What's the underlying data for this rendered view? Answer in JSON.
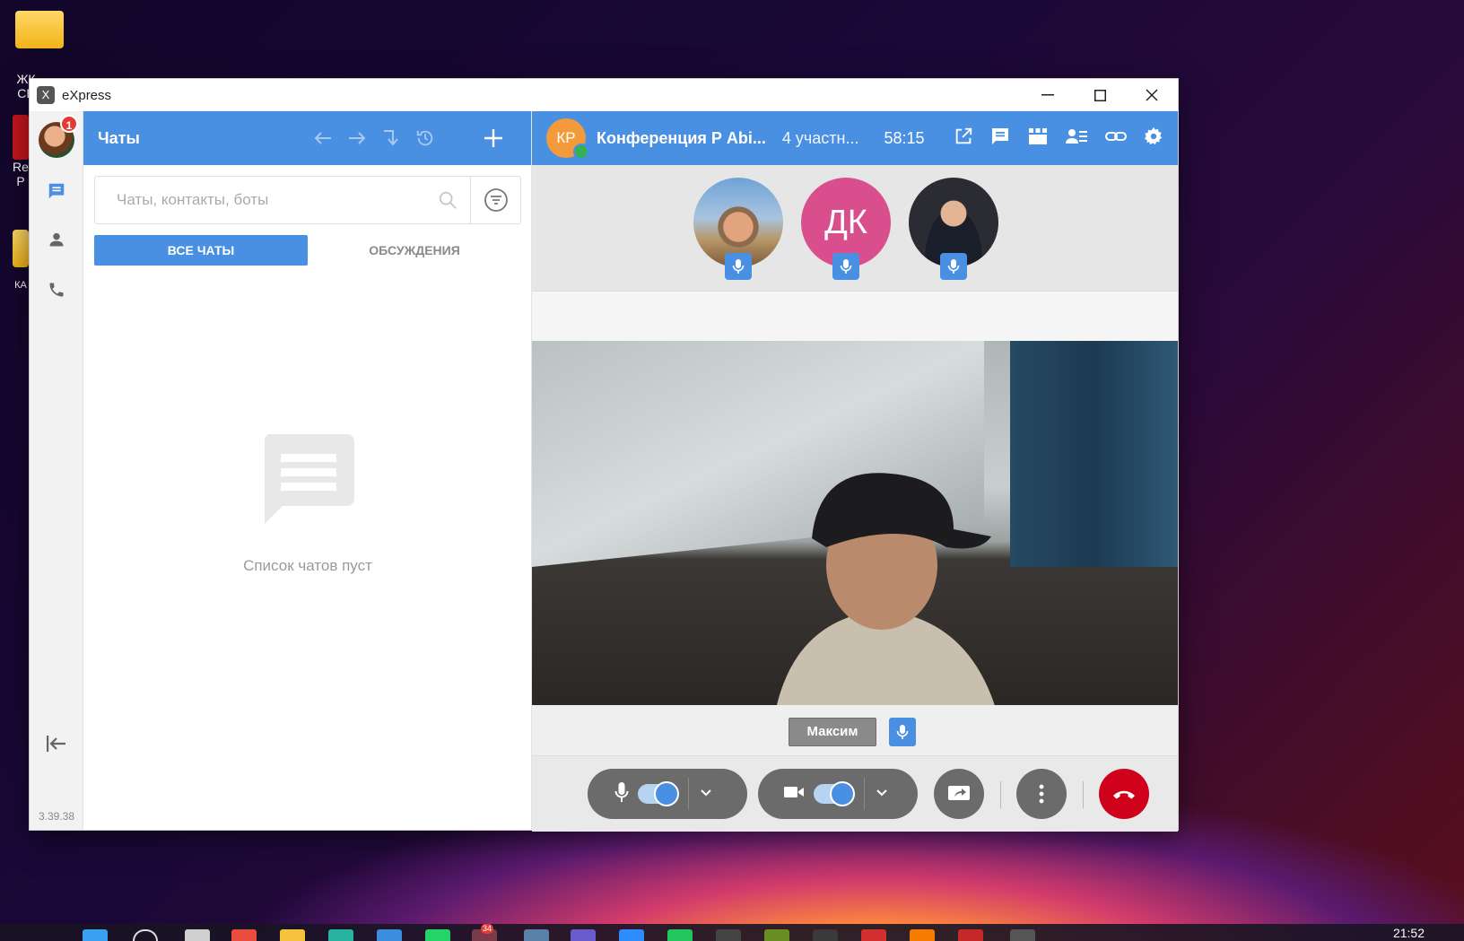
{
  "desktop": {
    "icons": [
      {
        "label": "ЖК СВ"
      },
      {
        "label": "Re P"
      },
      {
        "label": "КА"
      }
    ]
  },
  "window": {
    "title": "eXpress",
    "controls": {
      "minimize": "—",
      "maximize": "☐",
      "close": "✕"
    }
  },
  "rail": {
    "badge_count": "1",
    "version": "3.39.38"
  },
  "chats": {
    "header_title": "Чаты",
    "search_placeholder": "Чаты, контакты, боты",
    "tabs": [
      {
        "label": "ВСЕ ЧАТЫ",
        "active": true
      },
      {
        "label": "ОБСУЖДЕНИЯ",
        "active": false
      }
    ],
    "empty_text": "Список чатов пуст"
  },
  "call": {
    "avatar_initials": "КР",
    "conference_name": "Конференция Р Abi...",
    "participants_count": "4 участн...",
    "timer": "58:15",
    "participants": [
      {
        "initials": "",
        "color": "#8a7a62"
      },
      {
        "initials": "ДК",
        "color": "#d94f8e"
      },
      {
        "initials": "",
        "color": "#2b2b33"
      }
    ],
    "speaker_name": "Максим",
    "mic_enabled": true,
    "camera_enabled": true
  },
  "taskbar": {
    "clock": "21:52",
    "badge": "34"
  },
  "colors": {
    "accent": "#4a90e2",
    "hangup": "#d0021b",
    "badge": "#e53935"
  }
}
